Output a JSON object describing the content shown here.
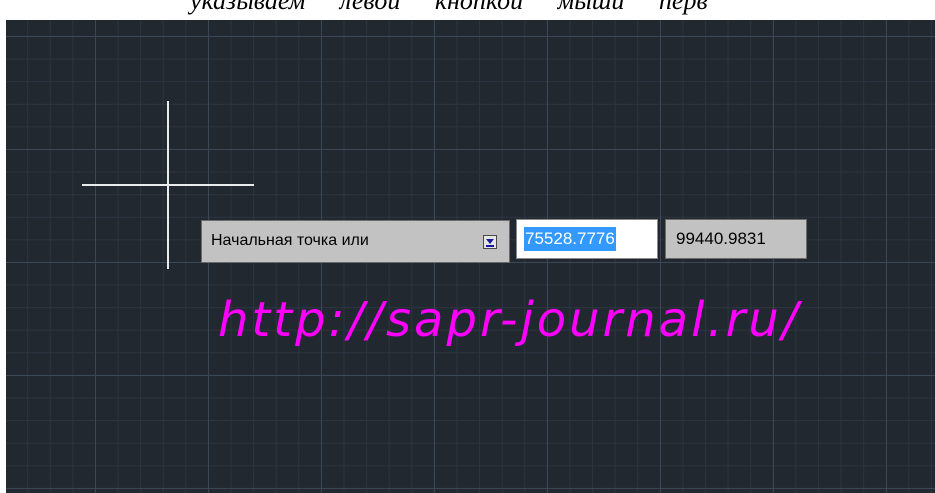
{
  "header_text": "указываем левой кнопкой мыши перв",
  "prompt": {
    "label": "Начальная точка или",
    "dropdown_icon": "options-dropdown-icon"
  },
  "coordinates": {
    "x_value": "75528.7776",
    "y_value": "99440.9831"
  },
  "watermark": "http://sapr-journal.ru/",
  "colors": {
    "canvas_background": "#212830",
    "grid_line": "#3c4858",
    "crosshair": "#e8ecef",
    "selection": "#3399ff",
    "watermark": "#ff00ff"
  }
}
